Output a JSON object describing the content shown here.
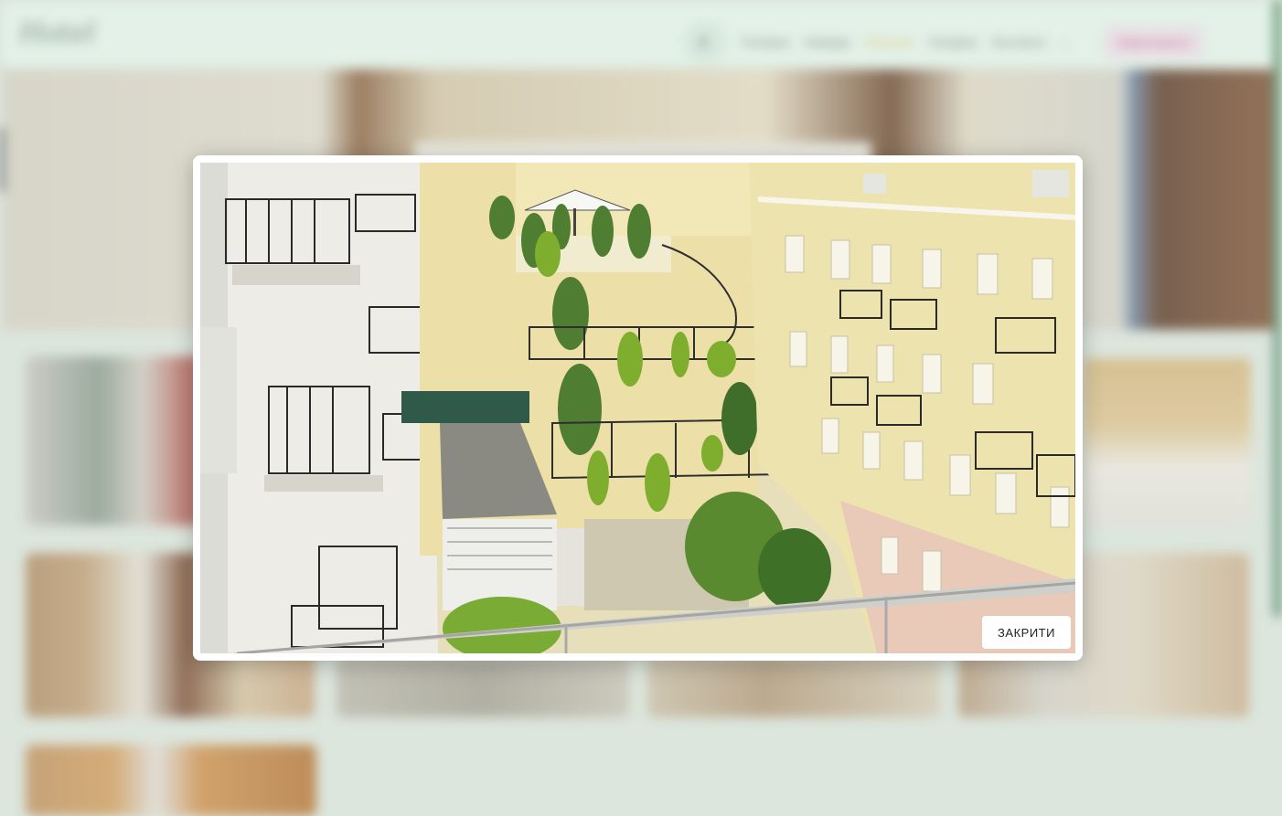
{
  "header": {
    "logo": "Hotel",
    "nav": [
      "Головна",
      "Номери",
      "Послуги",
      "Галерея",
      "Контакти"
    ],
    "active_index": 2,
    "cta": "Забронювати"
  },
  "modal": {
    "close_label": "ЗАКРИТИ",
    "image_name": "courtyard-photo"
  },
  "colors": {
    "header_bg": "#e8f7ee",
    "accent": "#e0b84a",
    "modal_bg": "#ffffff"
  }
}
